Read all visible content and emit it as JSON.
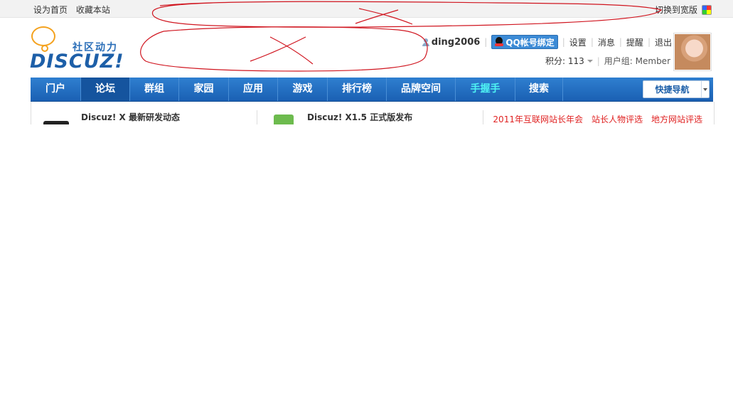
{
  "topbar": {
    "set_home": "设为首页",
    "bookmark": "收藏本站",
    "switch_wide": "切换到宽版"
  },
  "header": {
    "logo_slogan": "社区动力",
    "logo_word": "DISCUZ!",
    "username": "ding2006",
    "qq_bind": "QQ帐号绑定",
    "settings": "设置",
    "messages": "消息",
    "reminders": "提醒",
    "logout": "退出",
    "points_label": "积分: 113",
    "usergroup_label": "用户组: Member"
  },
  "nav": {
    "items": [
      {
        "label": "门户"
      },
      {
        "label": "论坛"
      },
      {
        "label": "群组"
      },
      {
        "label": "家园"
      },
      {
        "label": "应用"
      },
      {
        "label": "游戏"
      },
      {
        "label": "排行榜"
      },
      {
        "label": "品牌空间"
      },
      {
        "label": "手握手"
      },
      {
        "label": "搜索"
      }
    ],
    "active": "论坛",
    "quick_nav": "快捷导航"
  },
  "announcements": {
    "news1": "Discuz! X 最新研发动态",
    "news2": "Discuz! X1.5 正式版发布",
    "red_links": [
      "2011年互联网站长年会",
      "站长人物评选",
      "地方网站评选"
    ]
  },
  "colors": {
    "nav_blue": "#1a60b3",
    "nav_active": "#15549e",
    "highlight_cyan": "#4ff4f4",
    "red_link": "#e02222",
    "scribble_red": "#d0151f"
  }
}
